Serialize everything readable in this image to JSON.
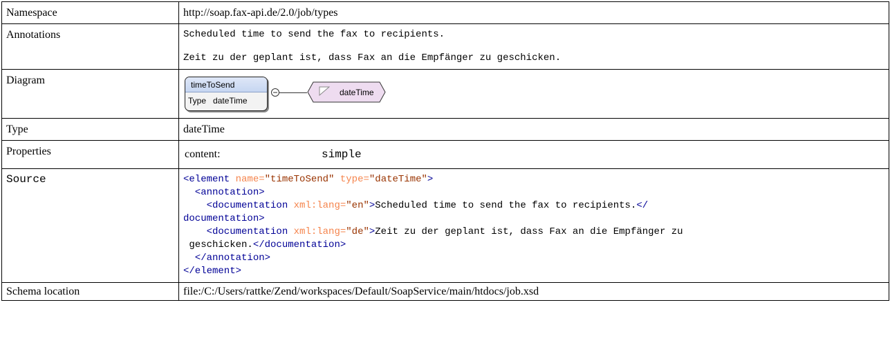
{
  "rows": {
    "namespace": {
      "label": "Namespace",
      "value": "http://soap.fax-api.de/2.0/job/types"
    },
    "annotations": {
      "label": "Annotations",
      "lines": [
        "Scheduled time to send the fax to recipients.",
        "Zeit zu der geplant ist, dass Fax an die Empfänger zu geschicken."
      ]
    },
    "diagram": {
      "label": "Diagram",
      "element_name": "timeToSend",
      "type_key": "Type",
      "type_value": "dateTime",
      "collapse_symbol": "−",
      "type_node_label": "dateTime"
    },
    "type": {
      "label": "Type",
      "value": "dateTime"
    },
    "properties": {
      "label": "Properties",
      "key": "content:",
      "value": "simple"
    },
    "source": {
      "label": "Source",
      "l1_open": "<element ",
      "l1_a1": "name=",
      "l1_v1": "\"timeToSend\"",
      "l1_a2": " type=",
      "l1_v2": "\"dateTime\"",
      "l1_close": ">",
      "l2": "  <annotation>",
      "l3_open": "    <documentation ",
      "l3_attr": "xml:lang=",
      "l3_val": "\"en\"",
      "l3_gt": ">",
      "l3_text": "Scheduled time to send the fax to recipients.",
      "l3_end": "</",
      "l4": "documentation>",
      "l5_open": "    <documentation ",
      "l5_attr": "xml:lang=",
      "l5_val": "\"de\"",
      "l5_gt": ">",
      "l5_text": "Zeit zu der geplant ist, dass Fax an die Empfänger zu",
      "l6_text": " geschicken.",
      "l6_end": "</documentation>",
      "l7": "  </annotation>",
      "l8": "</element>"
    },
    "schema_location": {
      "label": "Schema location",
      "value": "file:/C:/Users/rattke/Zend/workspaces/Default/SoapService/main/htdocs/job.xsd"
    }
  },
  "colors": {
    "tag": "#000096",
    "attribute": "#f5844c",
    "attribute_value": "#993300",
    "type_node_fill": "#eedcf0",
    "element_header": "#c6d6f1"
  }
}
